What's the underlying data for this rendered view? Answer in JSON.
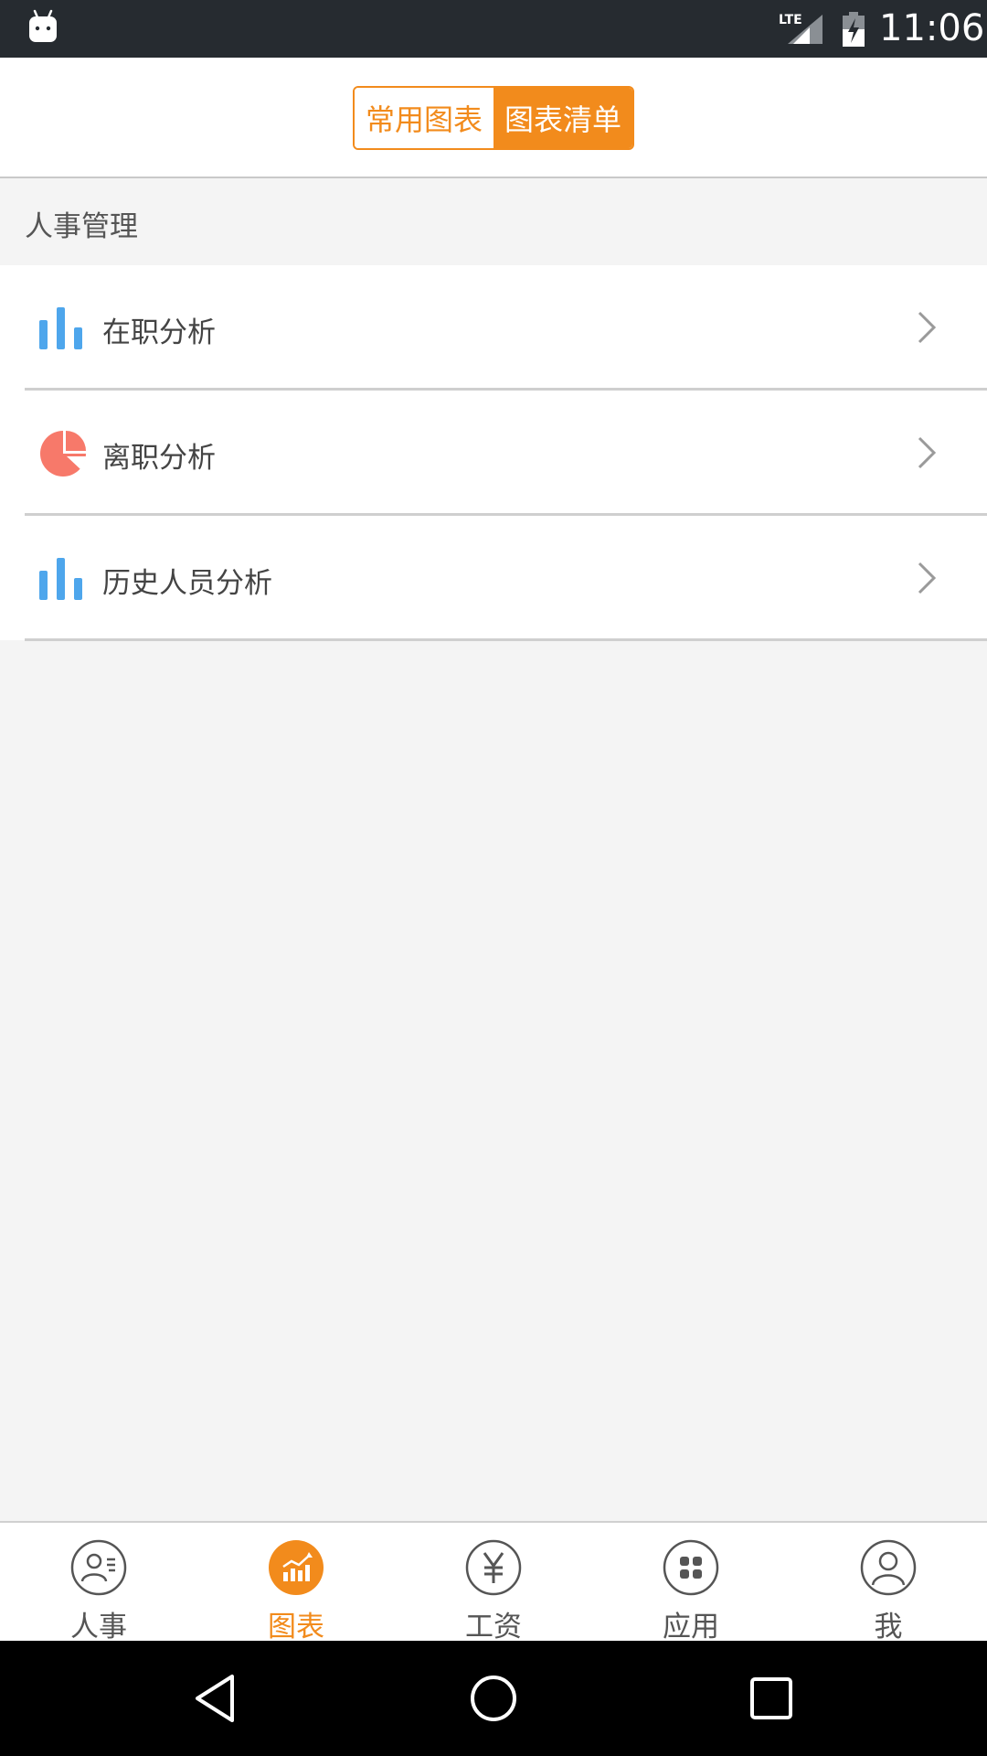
{
  "status_bar": {
    "network": "LTE",
    "time": "11:06",
    "icons": [
      "android-icon",
      "signal-icon",
      "battery-charging-icon"
    ]
  },
  "header": {
    "tabs": [
      {
        "label": "常用图表",
        "active": false
      },
      {
        "label": "图表清单",
        "active": true
      }
    ]
  },
  "section": {
    "title": "人事管理"
  },
  "list": {
    "items": [
      {
        "label": "在职分析",
        "icon": "bar-chart-icon"
      },
      {
        "label": "离职分析",
        "icon": "pie-chart-icon"
      },
      {
        "label": "历史人员分析",
        "icon": "bar-chart-icon"
      }
    ]
  },
  "bottom_nav": {
    "items": [
      {
        "label": "人事",
        "icon": "person-card-icon",
        "active": false
      },
      {
        "label": "图表",
        "icon": "chart-icon",
        "active": true
      },
      {
        "label": "工资",
        "icon": "yen-icon",
        "active": false
      },
      {
        "label": "应用",
        "icon": "apps-grid-icon",
        "active": false
      },
      {
        "label": "我",
        "icon": "profile-icon",
        "active": false
      }
    ]
  },
  "colors": {
    "accent": "#f28b1c",
    "bar_icon": "#4ea6ec",
    "pie_icon": "#f7796a"
  }
}
